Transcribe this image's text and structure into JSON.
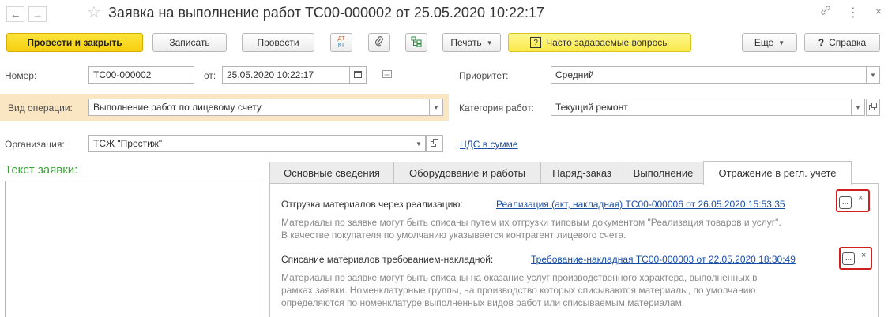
{
  "window": {
    "title": "Заявка на выполнение работ ТС00-000002 от 25.05.2020 10:22:17",
    "back_glyph": "←",
    "forward_glyph": "→",
    "star_glyph": "☆",
    "link_glyph": "🔗",
    "more_glyph": "⋮",
    "close_glyph": "×"
  },
  "toolbar": {
    "post_close_label": "Провести и закрыть",
    "save_label": "Записать",
    "post_label": "Провести",
    "dtkt_top": "ДТ",
    "dtkt_bottom": "КТ",
    "attach_glyph": "🖇",
    "structure_glyph": "品",
    "print_label": "Печать",
    "faq_label": "Часто задаваемые вопросы",
    "faq_glyph": "?",
    "more_label": "Еще",
    "help_label": "Справка",
    "help_glyph": "?"
  },
  "form": {
    "number_label": "Номер:",
    "number_value": "ТС00-000002",
    "from_label": "от:",
    "date_value": "25.05.2020 10:22:17",
    "priority_label": "Приоритет:",
    "priority_value": "Средний",
    "op_type_label": "Вид операции:",
    "op_type_value": "Выполнение работ по лицевому счету",
    "work_cat_label": "Категория работ:",
    "work_cat_value": "Текущий ремонт",
    "org_label": "Организация:",
    "org_value": "ТСЖ \"Престиж\"",
    "vat_link": "НДС в сумме",
    "request_text_label": "Текст заявки:"
  },
  "tabs": [
    {
      "label": "Основные сведения"
    },
    {
      "label": "Оборудование и работы"
    },
    {
      "label": "Наряд-заказ"
    },
    {
      "label": "Выполнение"
    },
    {
      "label": "Отражение в регл. учете"
    }
  ],
  "accounting": {
    "shipment_label": "Отгрузка материалов через реализацию:",
    "shipment_link": "Реализация (акт, накладная) ТС00-000006 от 26.05.2020 15:53:35",
    "shipment_hint_1": "Материалы по заявке могут быть списаны путем их отгрузки типовым документом \"Реализация товаров и услуг\".",
    "shipment_hint_2": "В качестве покупателя по умолчанию указывается контрагент лицевого счета.",
    "writeoff_label": "Списание материалов требованием-накладной:",
    "writeoff_link": "Требование-накладная ТС00-000003 от 22.05.2020 18:30:49",
    "writeoff_hint_1": "Материалы по заявке могут быть списаны на оказание услуг производственного характера, выполненных в",
    "writeoff_hint_2": "рамках заявки. Номенклатурные группы, на производство которых списываются материалы, по умолчанию",
    "writeoff_hint_3": "определяются по номенклатуре выполненных видов работ или списываемым материалам.",
    "ellipsis_glyph": "...",
    "clear_glyph": "×"
  },
  "colors": {
    "primary_button": "#f6cf11",
    "highlight_row": "#fbe6c3",
    "link": "#1a4ea5",
    "request_label": "#3aa43a",
    "annotation_box": "#d11f1f"
  }
}
